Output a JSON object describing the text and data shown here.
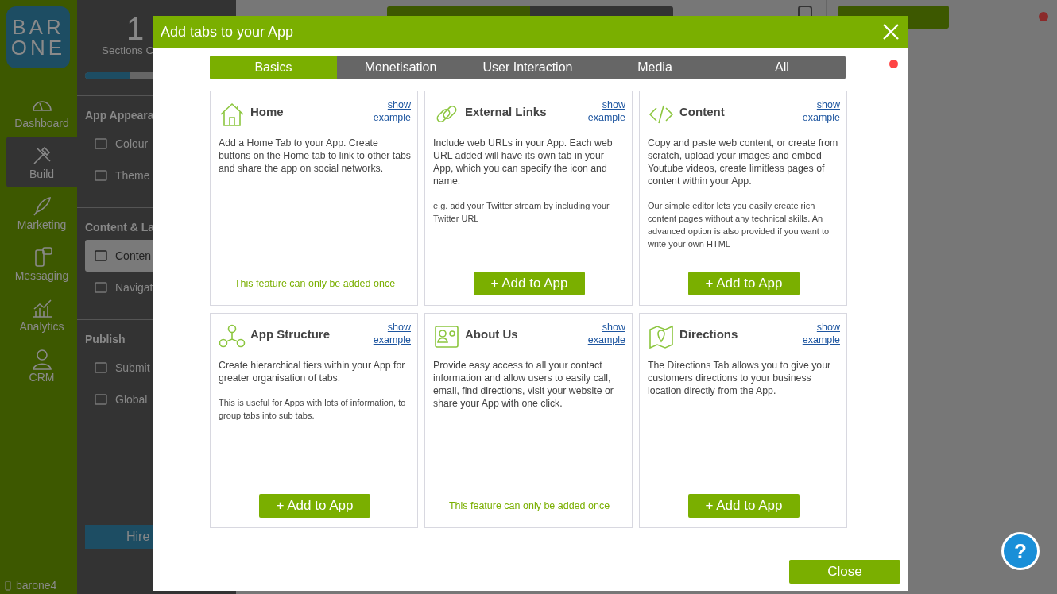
{
  "sidebar": {
    "logo": [
      "BAR",
      "ONE"
    ],
    "items": [
      {
        "label": "Dashboard",
        "selected": false
      },
      {
        "label": "Build",
        "selected": true
      },
      {
        "label": "Marketing",
        "selected": false
      },
      {
        "label": "Messaging",
        "selected": false
      },
      {
        "label": "Analytics",
        "selected": false
      },
      {
        "label": "CRM",
        "selected": false
      }
    ],
    "user": "barone4"
  },
  "panel": {
    "count": "1",
    "count_label": "Sections C",
    "progress": {
      "level": 0.3
    },
    "groups": [
      {
        "heading": "App Appeara",
        "items": [
          {
            "label": "Colour",
            "selected": false
          },
          {
            "label": "Theme",
            "selected": false
          }
        ]
      },
      {
        "heading": "Content & La",
        "items": [
          {
            "label": "Conten",
            "selected": true
          },
          {
            "label": "Navigat",
            "selected": false
          }
        ]
      },
      {
        "heading": "Publish",
        "items": [
          {
            "label": "Submit",
            "selected": false
          },
          {
            "label": "Global",
            "selected": false
          }
        ]
      }
    ],
    "hire_button": "Hire"
  },
  "dialog": {
    "title": "Add tabs to your App",
    "tabs": [
      {
        "label": "Basics",
        "selected": true
      },
      {
        "label": "Monetisation",
        "selected": false
      },
      {
        "label": "User Interaction",
        "selected": false
      },
      {
        "label": "Media",
        "selected": false
      },
      {
        "label": "All",
        "selected": false
      }
    ],
    "cards": [
      {
        "title": "Home",
        "link": [
          "show",
          "example"
        ],
        "text": [
          "Add a Home Tab to your App. Create buttons on the Home tab to link to other tabs and share the app on social networks."
        ],
        "footer": {
          "kind": "note",
          "text": "This feature can only be added once"
        }
      },
      {
        "title": "External Links",
        "link": [
          "show",
          "example"
        ],
        "text": [
          "Include web URLs in your App. Each web URL added will have its own tab in your App, which you can specify the icon and name.",
          "e.g. add your Twitter stream by including your Twitter URL"
        ],
        "footer": {
          "kind": "button",
          "text": "+ Add to App"
        }
      },
      {
        "title": "Content",
        "link": [
          "show",
          "example"
        ],
        "text": [
          "Copy and paste web content, or create from scratch, upload your images and embed Youtube videos, create limitless pages of content within your App.",
          "Our simple editor lets you easily create rich content pages without any technical skills. An advanced option is also provided if you want to write your own HTML"
        ],
        "footer": {
          "kind": "button",
          "text": "+ Add to App"
        }
      },
      {
        "title": "App Structure",
        "link": [
          "show",
          "example"
        ],
        "text": [
          "Create hierarchical tiers within your App for greater organisation of tabs.",
          "This is useful for Apps with lots of information, to group tabs into sub tabs."
        ],
        "footer": {
          "kind": "button",
          "text": "+ Add to App"
        }
      },
      {
        "title": "About Us",
        "link": [
          "show",
          "example"
        ],
        "text": [
          "Provide easy access to all your contact information and allow users to easily call, email, find directions, visit your website or share your App with one click."
        ],
        "footer": {
          "kind": "note",
          "text": "This feature can only be added once"
        }
      },
      {
        "title": "Directions",
        "link": [
          "show",
          "example"
        ],
        "text": [
          "The Directions Tab allows you to give your customers directions to your business location directly from the App."
        ],
        "footer": {
          "kind": "button",
          "text": "+ Add to App"
        }
      }
    ],
    "close_button": "Close"
  },
  "help_button": "?"
}
